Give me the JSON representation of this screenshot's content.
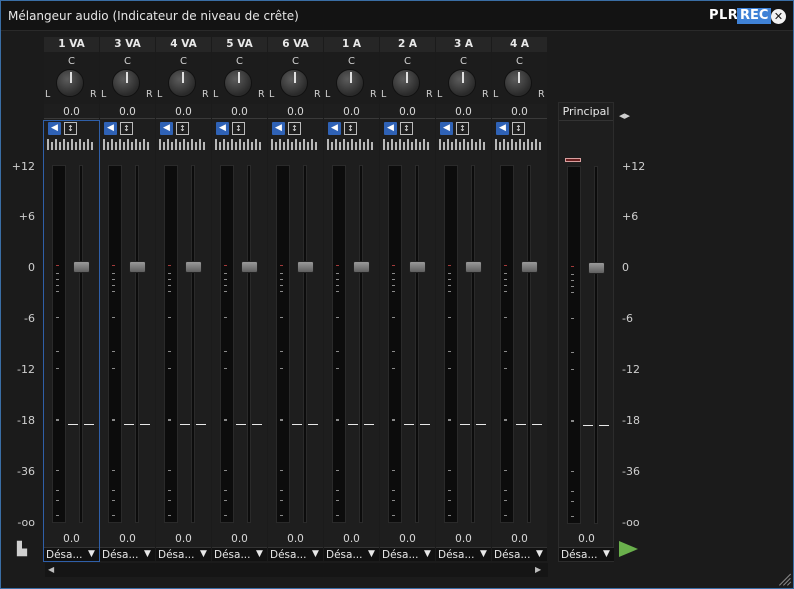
{
  "window": {
    "title": "Mélangeur audio (Indicateur de niveau de crête)",
    "brand_plr": "PLR",
    "brand_rec": "REC",
    "close_glyph": "✕",
    "accent_color": "#3f82d6",
    "frame_color": "#3a6ea5"
  },
  "scale_labels": [
    "+12",
    "+6",
    "0",
    "-6",
    "-12",
    "-18",
    "-36",
    "-oo"
  ],
  "channels": [
    {
      "name": "1 VA",
      "pan_center": "C",
      "pan_left": "L",
      "pan_right": "R",
      "pan_value": "0.0",
      "volume": "0.0",
      "output": "Désa...",
      "selected": true
    },
    {
      "name": "3 VA",
      "pan_center": "C",
      "pan_left": "L",
      "pan_right": "R",
      "pan_value": "0.0",
      "volume": "0.0",
      "output": "Désa...",
      "selected": false
    },
    {
      "name": "4 VA",
      "pan_center": "C",
      "pan_left": "L",
      "pan_right": "R",
      "pan_value": "0.0",
      "volume": "0.0",
      "output": "Désa...",
      "selected": false
    },
    {
      "name": "5 VA",
      "pan_center": "C",
      "pan_left": "L",
      "pan_right": "R",
      "pan_value": "0.0",
      "volume": "0.0",
      "output": "Désa...",
      "selected": false
    },
    {
      "name": "6 VA",
      "pan_center": "C",
      "pan_left": "L",
      "pan_right": "R",
      "pan_value": "0.0",
      "volume": "0.0",
      "output": "Désa...",
      "selected": false
    },
    {
      "name": "1 A",
      "pan_center": "C",
      "pan_left": "L",
      "pan_right": "R",
      "pan_value": "0.0",
      "volume": "0.0",
      "output": "Désa...",
      "selected": false
    },
    {
      "name": "2 A",
      "pan_center": "C",
      "pan_left": "L",
      "pan_right": "R",
      "pan_value": "0.0",
      "volume": "0.0",
      "output": "Désa...",
      "selected": false
    },
    {
      "name": "3 A",
      "pan_center": "C",
      "pan_left": "L",
      "pan_right": "R",
      "pan_value": "0.0",
      "volume": "0.0",
      "output": "Désa...",
      "selected": false
    },
    {
      "name": "4 A",
      "pan_center": "C",
      "pan_left": "L",
      "pan_right": "R",
      "pan_value": "0.0",
      "volume": "0.0",
      "output": "Désa...",
      "selected": false
    }
  ],
  "master": {
    "name": "Principal",
    "volume": "0.0",
    "output": "Désa..."
  },
  "icons": {
    "mute": "speaker-icon",
    "io": "input-output-icon",
    "eq": "eq-icon",
    "routing": "routing-icon",
    "play": "play-icon",
    "meter_options": "meter-options-icon"
  },
  "glyphs": {
    "speaker": "◀",
    "io": "↕",
    "caret": "▼",
    "scroll_left": "◀",
    "scroll_right": "▶",
    "routing": "◂▸",
    "meter_options": "▙"
  },
  "colors": {
    "play": "#6ab04c",
    "mute": "#2f62b6",
    "clip": "#6a1f1f"
  }
}
